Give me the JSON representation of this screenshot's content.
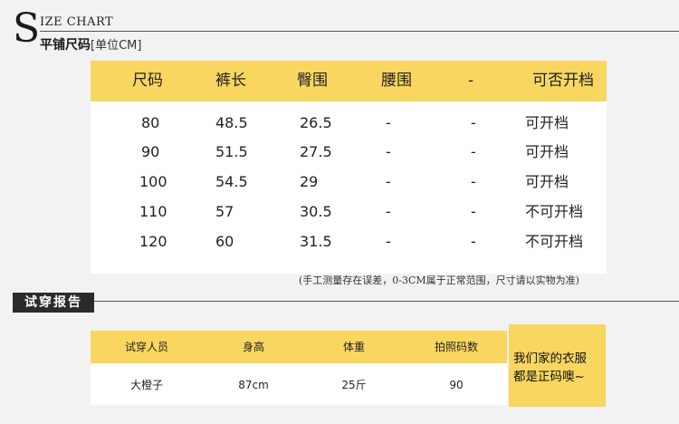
{
  "header": {
    "s_letter": "S",
    "size_chart": "IZE CHART",
    "subtitle": "平铺尺码",
    "unit": "[单位CM]"
  },
  "size_table": {
    "columns": [
      "尺码",
      "裤长",
      "臀围",
      "腰围",
      "-",
      "可否开档"
    ],
    "rows": [
      [
        "80",
        "48.5",
        "26.5",
        "-",
        "-",
        "可开档"
      ],
      [
        "90",
        "51.5",
        "27.5",
        "-",
        "-",
        "可开档"
      ],
      [
        "100",
        "54.5",
        "29",
        "-",
        "-",
        "可开档"
      ],
      [
        "110",
        "57",
        "30.5",
        "-",
        "-",
        "不可开档"
      ],
      [
        "120",
        "60",
        "31.5",
        "-",
        "-",
        "不可开档"
      ]
    ],
    "note": "(手工测量存在误差，0-3CM属于正常范围，尺寸请以实物为准)"
  },
  "try_on": {
    "title": "试穿报告",
    "columns": [
      "试穿人员",
      "身高",
      "体重",
      "拍照码数"
    ],
    "row": [
      "大橙子",
      "87cm",
      "25斤",
      "90"
    ],
    "side_line1": "我们家的衣服",
    "side_line2": "都是正码噢~"
  }
}
